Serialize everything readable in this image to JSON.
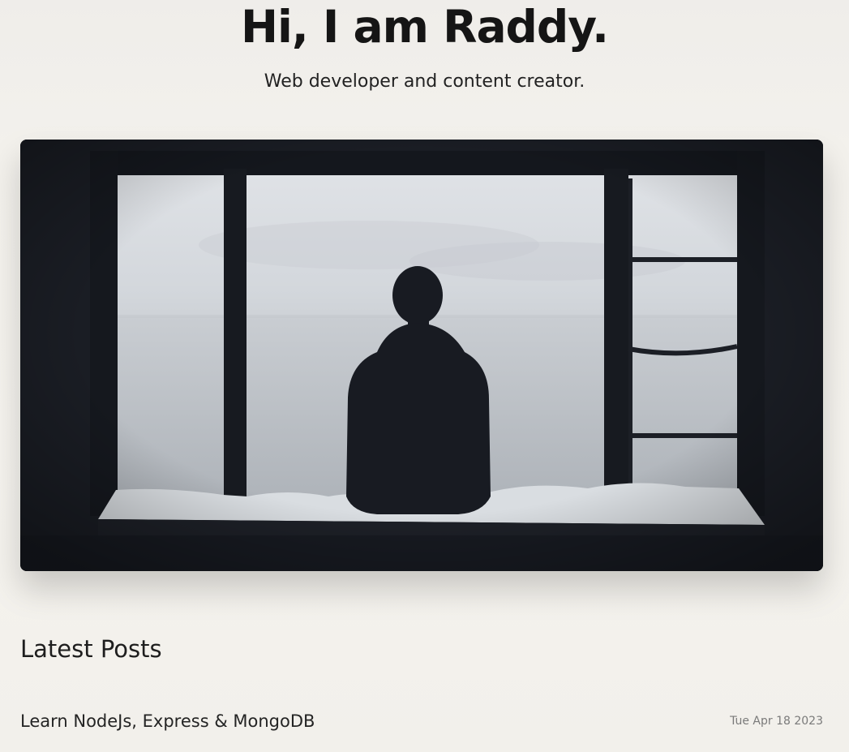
{
  "hero": {
    "title": "Hi, I am Raddy.",
    "subtitle": "Web developer and content creator.",
    "image_alt": "Silhouette of a person sitting in a window looking out at a misty sea"
  },
  "latest_posts": {
    "heading": "Latest Posts",
    "items": [
      {
        "title": "Learn NodeJs, Express & MongoDB",
        "date": "Tue Apr 18 2023"
      }
    ]
  },
  "colors": {
    "background": "#f3f1ec",
    "text": "#151515",
    "muted": "#7a7a7a"
  }
}
